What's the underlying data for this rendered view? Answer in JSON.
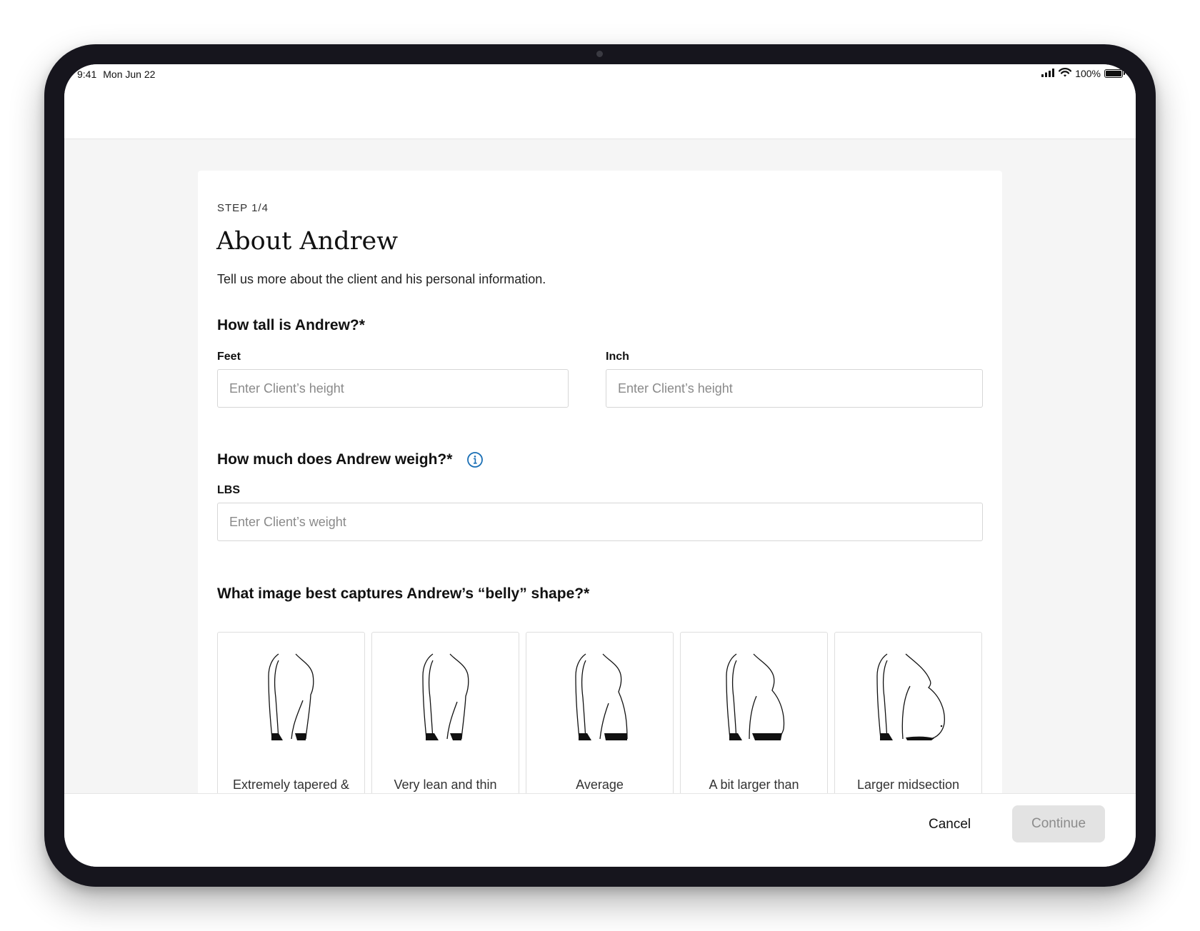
{
  "status_bar": {
    "time": "9:41",
    "date": "Mon Jun 22",
    "battery": "100%"
  },
  "form": {
    "step": "STEP 1/4",
    "title": "About Andrew",
    "subtitle": "Tell us more about the client and his personal information.",
    "height_question": "How tall is Andrew?*",
    "feet_label": "Feet",
    "feet_placeholder": "Enter Client’s height",
    "inch_label": "Inch",
    "inch_placeholder": "Enter Client’s height",
    "weight_question": "How much does Andrew weigh?*",
    "lbs_label": "LBS",
    "weight_placeholder": "Enter Client’s weight",
    "belly_question": "What image best captures Andrew’s “belly” shape?*",
    "belly_options": [
      {
        "label": "Extremely tapered &"
      },
      {
        "label": "Very lean and thin"
      },
      {
        "label": "Average"
      },
      {
        "label": "A bit larger than"
      },
      {
        "label": "Larger midsection"
      }
    ]
  },
  "footer": {
    "cancel": "Cancel",
    "continue": "Continue"
  },
  "colors": {
    "accent": "#1a6fb5",
    "disabled_bg": "#e3e3e3",
    "disabled_text": "#8c8c8c"
  }
}
